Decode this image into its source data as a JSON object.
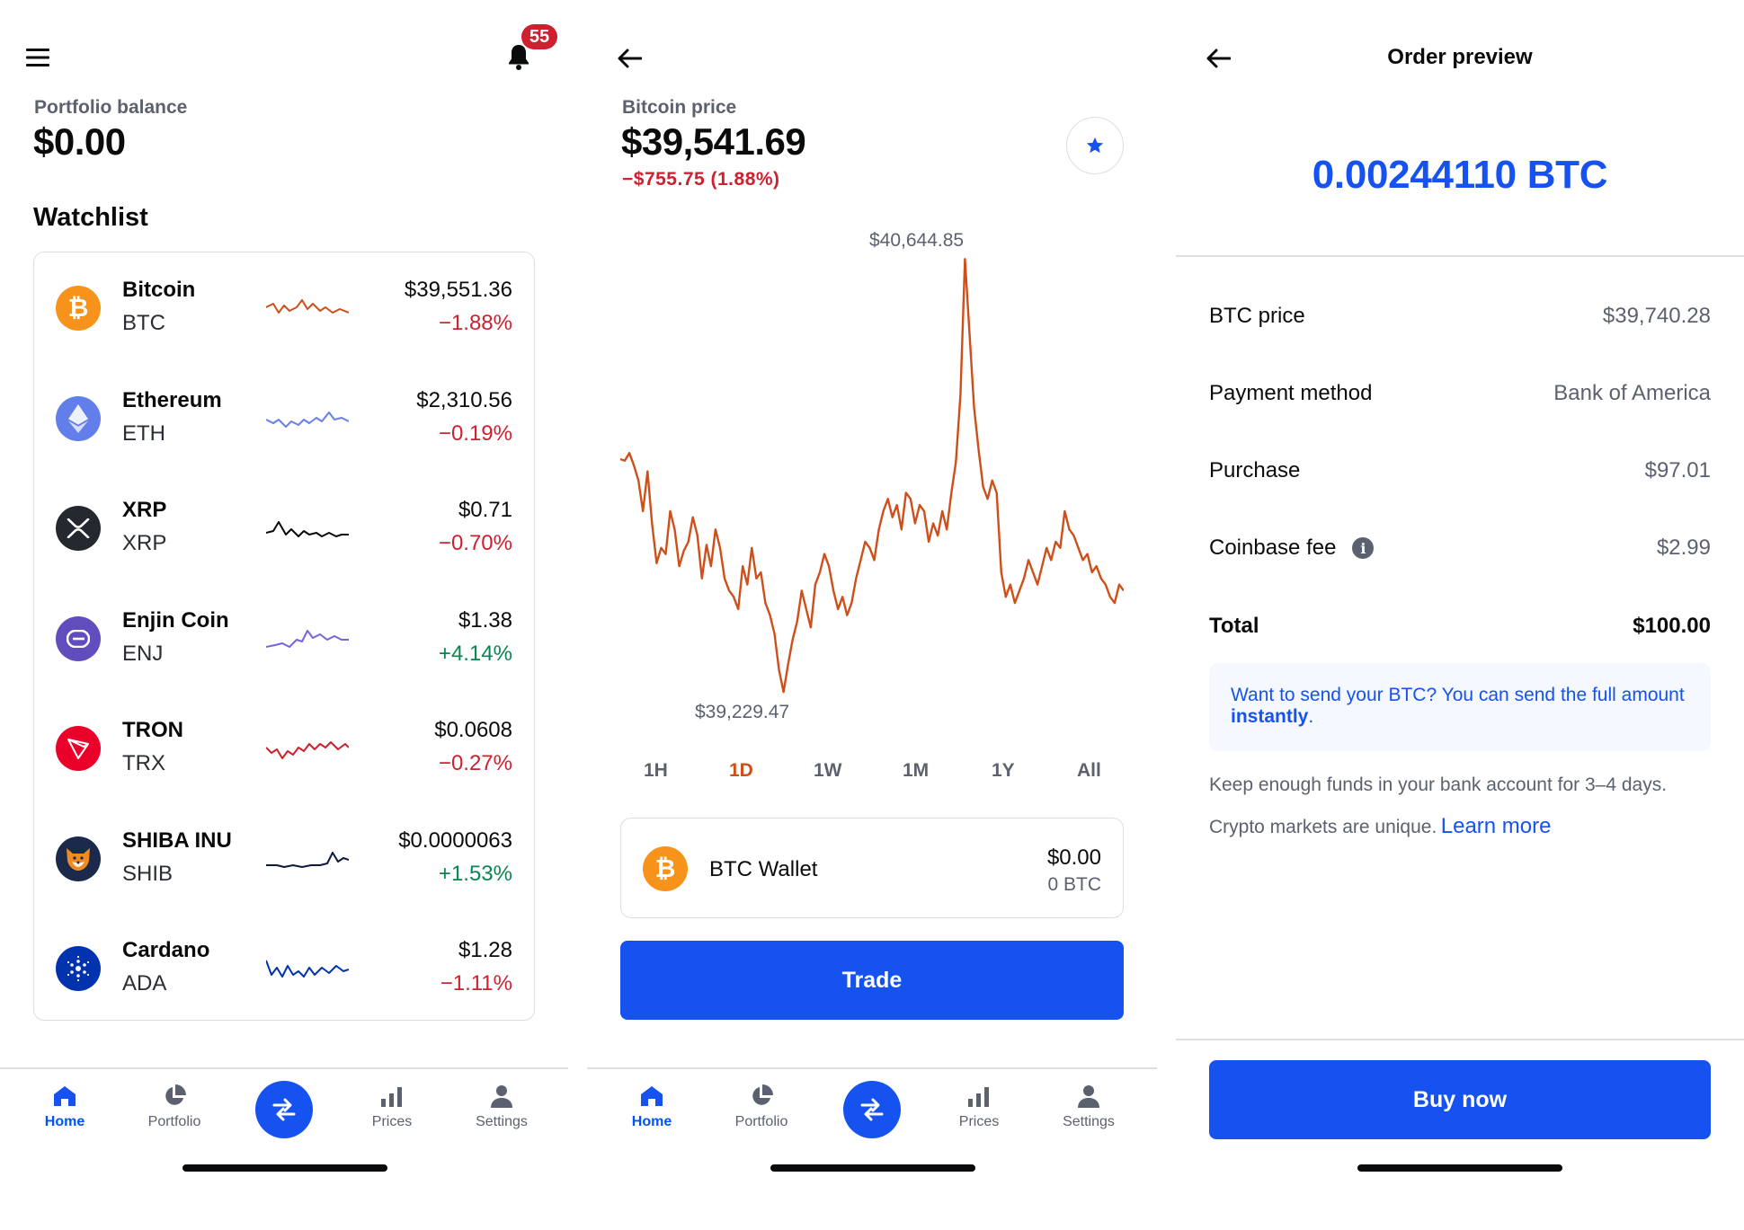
{
  "colors": {
    "brand_blue": "#1652f0",
    "negative": "#cf202f",
    "positive": "#098551",
    "btc_chart": "#cf4f1a",
    "muted": "#5b616e"
  },
  "home": {
    "menu_icon": "hamburger-icon",
    "notification_icon": "bell-icon",
    "notification_count": "55",
    "balance_label": "Portfolio balance",
    "balance_value": "$0.00",
    "watchlist_title": "Watchlist",
    "watchlist": [
      {
        "name": "Bitcoin",
        "symbol": "BTC",
        "price": "$39,551.36",
        "change": "−1.88%",
        "direction": "down",
        "icon": "bitcoin-icon",
        "color": "#f7931a",
        "spark_color": "#cf4f1a"
      },
      {
        "name": "Ethereum",
        "symbol": "ETH",
        "price": "$2,310.56",
        "change": "−0.19%",
        "direction": "down",
        "icon": "ethereum-icon",
        "color": "#627eea",
        "spark_color": "#6b7fe8"
      },
      {
        "name": "XRP",
        "symbol": "XRP",
        "price": "$0.71",
        "change": "−0.70%",
        "direction": "down",
        "icon": "xrp-icon",
        "color": "#23292f",
        "spark_color": "#0a0b0d"
      },
      {
        "name": "Enjin Coin",
        "symbol": "ENJ",
        "price": "$1.38",
        "change": "+4.14%",
        "direction": "up",
        "icon": "enjin-icon",
        "color": "#624dbf",
        "spark_color": "#7a63d6"
      },
      {
        "name": "TRON",
        "symbol": "TRX",
        "price": "$0.0608",
        "change": "−0.27%",
        "direction": "down",
        "icon": "tron-icon",
        "color": "#eb0029",
        "spark_color": "#cf202f"
      },
      {
        "name": "SHIBA INU",
        "symbol": "SHIB",
        "price": "$0.0000063",
        "change": "+1.53%",
        "direction": "up",
        "icon": "shiba-inu-icon",
        "color": "#1b2a4a",
        "spark_color": "#0e1a3d"
      },
      {
        "name": "Cardano",
        "symbol": "ADA",
        "price": "$1.28",
        "change": "−1.11%",
        "direction": "down",
        "icon": "cardano-icon",
        "color": "#0033ad",
        "spark_color": "#0033ad"
      }
    ]
  },
  "nav": {
    "tabs": [
      {
        "label": "Home",
        "icon": "home-icon",
        "active": true
      },
      {
        "label": "Portfolio",
        "icon": "pie-chart-icon",
        "active": false
      },
      {
        "label": "Prices",
        "icon": "bar-chart-icon",
        "active": false
      },
      {
        "label": "Settings",
        "icon": "person-icon",
        "active": false
      }
    ],
    "center_icon": "swap-arrows-icon"
  },
  "asset": {
    "back_icon": "back-arrow-icon",
    "price_label": "Bitcoin price",
    "price_value": "$39,541.69",
    "change_text": "−$755.75 (1.88%)",
    "star_icon": "star-icon",
    "high_label": "$40,644.85",
    "low_label": "$39,229.47",
    "ranges": [
      "1H",
      "1D",
      "1W",
      "1M",
      "1Y",
      "All"
    ],
    "active_range": "1D",
    "wallet": {
      "name": "BTC Wallet",
      "fiat": "$0.00",
      "crypto": "0 BTC",
      "icon": "bitcoin-icon"
    },
    "trade_label": "Trade"
  },
  "chart_data": {
    "type": "line",
    "title": "",
    "xlabel": "",
    "ylabel": "",
    "series": [
      {
        "values": [
          39990,
          39985,
          40010,
          39970,
          39920,
          39820,
          39950,
          39780,
          39650,
          39700,
          39680,
          39820,
          39760,
          39640,
          39690,
          39720,
          39800,
          39740,
          39600,
          39710,
          39640,
          39760,
          39700,
          39600,
          39560,
          39540,
          39500,
          39640,
          39580,
          39700,
          39600,
          39620,
          39520,
          39480,
          39420,
          39300,
          39229,
          39320,
          39400,
          39460,
          39560,
          39500,
          39440,
          39580,
          39620,
          39680,
          39640,
          39560,
          39500,
          39540,
          39480,
          39520,
          39600,
          39660,
          39720,
          39700,
          39660,
          39760,
          39820,
          39860,
          39800,
          39840,
          39760,
          39880,
          39860,
          39780,
          39840,
          39820,
          39720,
          39780,
          39740,
          39820,
          39760,
          39880,
          39980,
          40200,
          40644,
          40400,
          40160,
          40020,
          39900,
          39860,
          39920,
          39880,
          39620,
          39540,
          39580,
          39520,
          39560,
          39600,
          39660,
          39620,
          39580,
          39640,
          39700,
          39660,
          39720,
          39700,
          39820,
          39760,
          39740,
          39700,
          39660,
          39680,
          39620,
          39640,
          39600,
          39580,
          39540,
          39520,
          39580,
          39560
        ]
      }
    ],
    "annotations": [
      "$40,644.85",
      "$39,229.47"
    ],
    "ylim": [
      39229.47,
      40644.85
    ],
    "grid": false,
    "color": "#cf4f1a"
  },
  "order": {
    "back_icon": "back-arrow-icon",
    "title": "Order preview",
    "amount": "0.00244110 BTC",
    "rows": [
      {
        "label": "BTC price",
        "value": "$39,740.28"
      },
      {
        "label": "Payment method",
        "value": "Bank of America"
      },
      {
        "label": "Purchase",
        "value": "$97.01"
      },
      {
        "label": "Coinbase fee",
        "value": "$2.99",
        "info": true
      }
    ],
    "total_label": "Total",
    "total_value": "$100.00",
    "note_text": "Want to send your BTC? You can send the full amount ",
    "note_link": "instantly",
    "note_end": ".",
    "funds_text": "Keep enough funds in your bank account for 3–4 days.",
    "markets_text": "Crypto markets are unique.",
    "learn_more": "Learn more",
    "buy_label": "Buy now"
  }
}
